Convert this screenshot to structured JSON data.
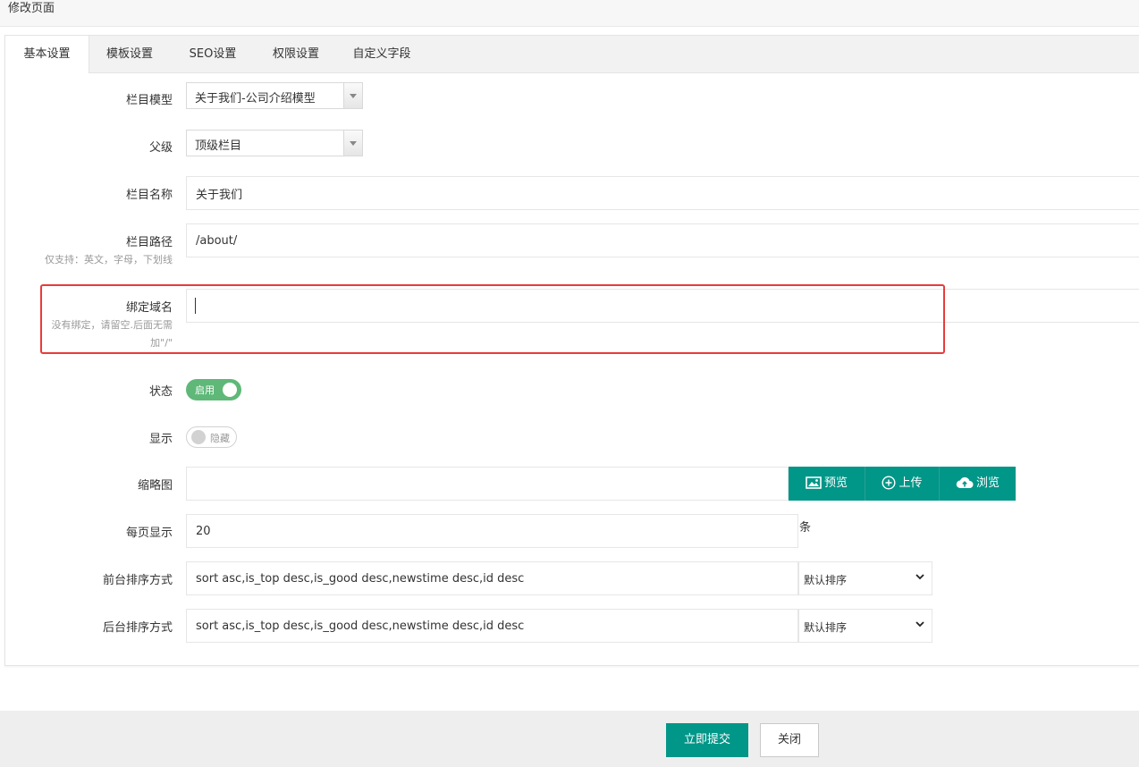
{
  "page": {
    "title": "修改页面"
  },
  "tabs": [
    {
      "label": "基本设置",
      "active": true
    },
    {
      "label": "模板设置"
    },
    {
      "label": "SEO设置"
    },
    {
      "label": "权限设置"
    },
    {
      "label": "自定义字段"
    }
  ],
  "form": {
    "model": {
      "label": "栏目模型",
      "value": "关于我们-公司介绍模型"
    },
    "parent": {
      "label": "父级",
      "value": "顶级栏目"
    },
    "name": {
      "label": "栏目名称",
      "value": "关于我们"
    },
    "path": {
      "label": "栏目路径",
      "hint": "仅支持：英文，字母，下划线",
      "value": "/about/"
    },
    "domain": {
      "label": "绑定域名",
      "hint_line1": "没有绑定，请留空.后面无需",
      "hint_line2": "加\"/\"",
      "value": ""
    },
    "status": {
      "label": "状态",
      "switch_text": "启用",
      "on": true
    },
    "display": {
      "label": "显示",
      "switch_text": "隐藏",
      "on": false
    },
    "thumbnail": {
      "label": "缩略图",
      "value": "",
      "buttons": {
        "preview": "预览",
        "upload": "上传",
        "browse": "浏览"
      }
    },
    "per_page": {
      "label": "每页显示",
      "value": "20",
      "unit": "条"
    },
    "front_sort": {
      "label": "前台排序方式",
      "value": "sort asc,is_top desc,is_good desc,newstime desc,id desc",
      "option": "默认排序"
    },
    "back_sort": {
      "label": "后台排序方式",
      "value": "sort asc,is_top desc,is_good desc,newstime desc,id desc",
      "option": "默认排序"
    }
  },
  "footer": {
    "submit": "立即提交",
    "close": "关闭"
  },
  "colors": {
    "primary": "#009688",
    "switch_on": "#5fb878",
    "highlight": "#e83b3b"
  }
}
